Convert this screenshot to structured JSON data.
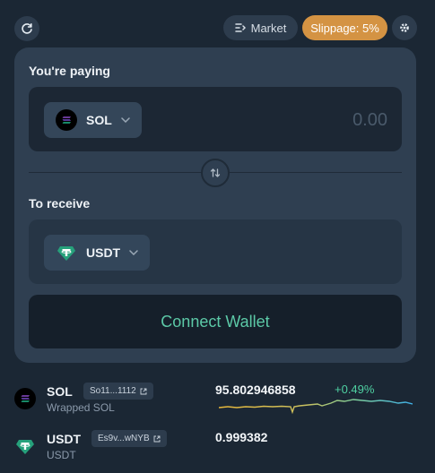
{
  "header": {
    "market_label": "Market",
    "slippage_label": "Slippage: 5%",
    "slippage_color": "#d49343"
  },
  "swap": {
    "paying_label": "You're paying",
    "paying_token": "SOL",
    "amount_placeholder": "0.00",
    "receive_label": "To receive",
    "receive_token": "USDT",
    "connect_label": "Connect Wallet",
    "accent_color": "#5cc9a7"
  },
  "tokens": [
    {
      "symbol": "SOL",
      "name": "Wrapped SOL",
      "address": "So11...1112",
      "price": "95.802946858",
      "change": "+0.49%",
      "icon": "solana-logo-icon"
    },
    {
      "symbol": "USDT",
      "name": "USDT",
      "address": "Es9v...wNYB",
      "price": "0.999382",
      "icon": "tether-logo-icon"
    }
  ]
}
